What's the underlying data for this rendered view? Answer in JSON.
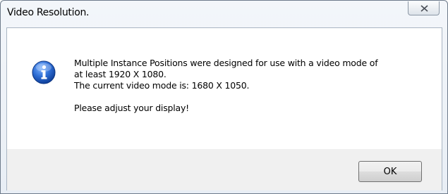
{
  "window": {
    "title": "Video Resolution."
  },
  "message": {
    "line1": "Multiple Instance Positions were designed for use with a video mode of",
    "line2": "at least 1920 X 1080.",
    "line3": "The current video mode is: 1680 X 1050.",
    "line4": "Please adjust your display!"
  },
  "buttons": {
    "ok_label": "OK"
  },
  "icons": {
    "info": "info-icon",
    "close": "close-icon"
  },
  "colors": {
    "info_icon_blue": "#1f5fbf",
    "window_border": "#6e7b8b",
    "footer_background": "#f0f0f0"
  }
}
